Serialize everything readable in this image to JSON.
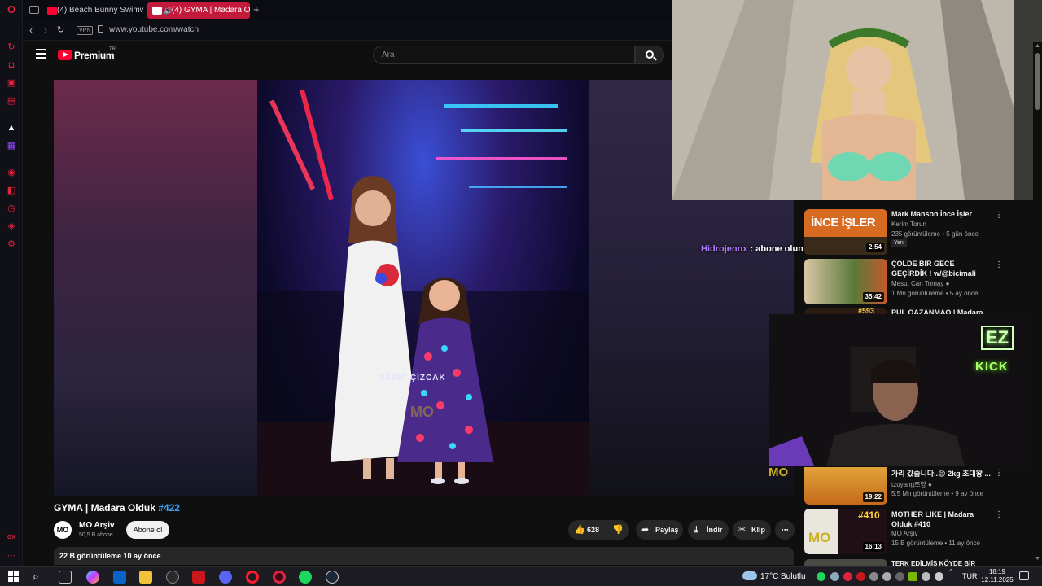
{
  "browser": {
    "tabs": [
      {
        "label": "(4) Beach Bunny Swimwe"
      },
      {
        "label": "(4) GYMA | Madara O"
      }
    ],
    "new_tab": "+",
    "vpn_badge": "VPN",
    "url": "www.youtube.com/watch",
    "sidebar_bottom_label": "GX"
  },
  "youtube": {
    "logo_text": "Premium",
    "logo_sup": "TR",
    "search_placeholder": "Ara",
    "video": {
      "title": "GYMA | Madara Olduk",
      "hashtag": "#422",
      "watermark": "MO",
      "caption": "YAZIR ÇİZCAK"
    },
    "channel": {
      "avatar_text": "MO",
      "name": "MO Arşiv",
      "subs": "50,5 B abone",
      "subscribe_label": "Abone ol"
    },
    "actions": {
      "likes": "628",
      "share": "Paylaş",
      "download": "İndir",
      "clip": "Klip",
      "more": "⋯"
    },
    "description_stats": "22 B görüntüleme  10 ay önce"
  },
  "chat": {
    "user": "Hidrojennx",
    "message": " : abone olun abone atın"
  },
  "stream": {
    "neon_top": "EZ",
    "neon_bottom": "KICK",
    "badge": "MO"
  },
  "recommendations": [
    {
      "title": "Mark Manson İnce İşler",
      "channel": "Kerim Torun",
      "meta": "235 görüntüleme • 5 gün önce",
      "badge": "Yeni",
      "duration": "2:54",
      "thumb_text": "İNCE İŞLER"
    },
    {
      "title": "ÇÖLDE BİR GECE GEÇİRDİK ! w/@bicimali",
      "channel": "Mesut Can Tomay",
      "meta": "1 Mn görüntüleme • 5 ay önce",
      "duration": "35:42"
    },
    {
      "title": "PUL QAZANMAQ | Madara",
      "channel": "",
      "meta": "",
      "duration": "",
      "thumb_text": "#593"
    },
    {
      "title": "가리 갔습니다..😄 2kg 초대왕 ...",
      "channel": "tzuyang쯔양",
      "meta": "5,5 Mn görüntüleme • 9 ay önce",
      "duration": "19:22"
    },
    {
      "title": "MOTHER LIKE | Madara Olduk #410",
      "channel": "MO Arşiv",
      "meta": "15 B görüntüleme • 11 ay önce",
      "duration": "16:13",
      "thumb_text": "#410"
    },
    {
      "title": "TERK EDİLMİŞ KÖYDE BİR GECE",
      "channel": "",
      "meta": "",
      "duration": ""
    }
  ],
  "taskbar": {
    "weather": "17°C",
    "weather_desc": "Bulutlu",
    "lang": "TUR",
    "time": "18:19",
    "date": "12.11.2025"
  },
  "colors": {
    "accent": "#e2233f",
    "yt_red": "#ff0033",
    "chat_user": "#b47cff",
    "hashtag": "#3ea6ff"
  }
}
